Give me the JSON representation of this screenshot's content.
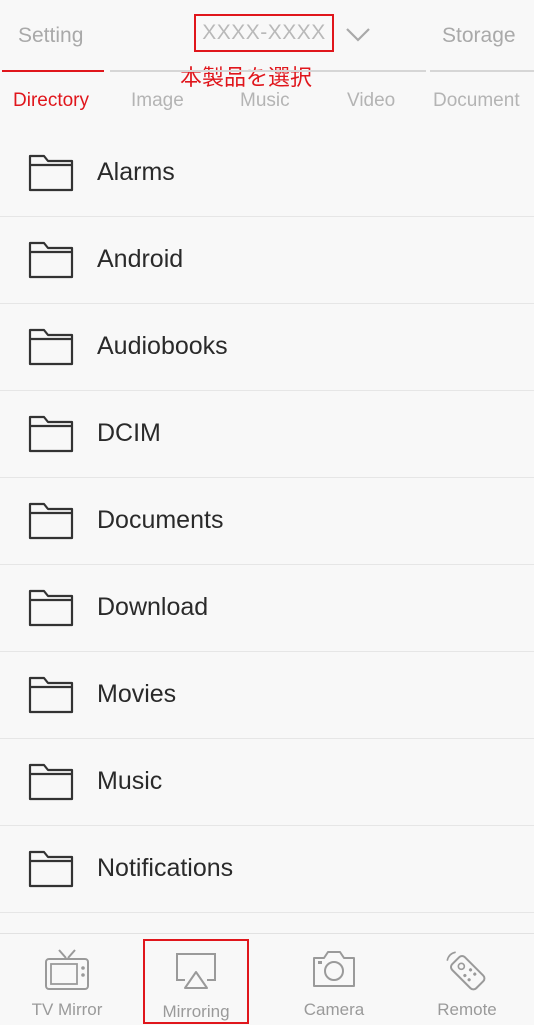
{
  "header": {
    "setting_label": "Setting",
    "device_name": "XXXX-XXXX",
    "storage_label": "Storage",
    "annotation": "本製品を選択"
  },
  "tabs": [
    {
      "label": "Directory",
      "active": true
    },
    {
      "label": "Image",
      "active": false
    },
    {
      "label": "Music",
      "active": false
    },
    {
      "label": "Video",
      "active": false
    },
    {
      "label": "Document",
      "active": false
    }
  ],
  "folders": [
    {
      "name": "Alarms",
      "icon": "folder-icon"
    },
    {
      "name": "Android",
      "icon": "folder-icon"
    },
    {
      "name": "Audiobooks",
      "icon": "folder-icon"
    },
    {
      "name": "DCIM",
      "icon": "folder-icon"
    },
    {
      "name": "Documents",
      "icon": "folder-icon"
    },
    {
      "name": "Download",
      "icon": "folder-icon"
    },
    {
      "name": "Movies",
      "icon": "folder-icon"
    },
    {
      "name": "Music",
      "icon": "folder-icon"
    },
    {
      "name": "Notifications",
      "icon": "folder-icon"
    }
  ],
  "bottom_nav": [
    {
      "label": "TV Mirror",
      "icon": "tv-icon"
    },
    {
      "label": "Mirroring",
      "icon": "airplay-icon",
      "highlighted": true
    },
    {
      "label": "Camera",
      "icon": "camera-icon"
    },
    {
      "label": "Remote",
      "icon": "remote-icon"
    }
  ],
  "colors": {
    "accent": "#e0161c",
    "inactive_text": "#b4b4b4",
    "list_text": "#2a2a2a",
    "background": "#f8f8f8"
  }
}
